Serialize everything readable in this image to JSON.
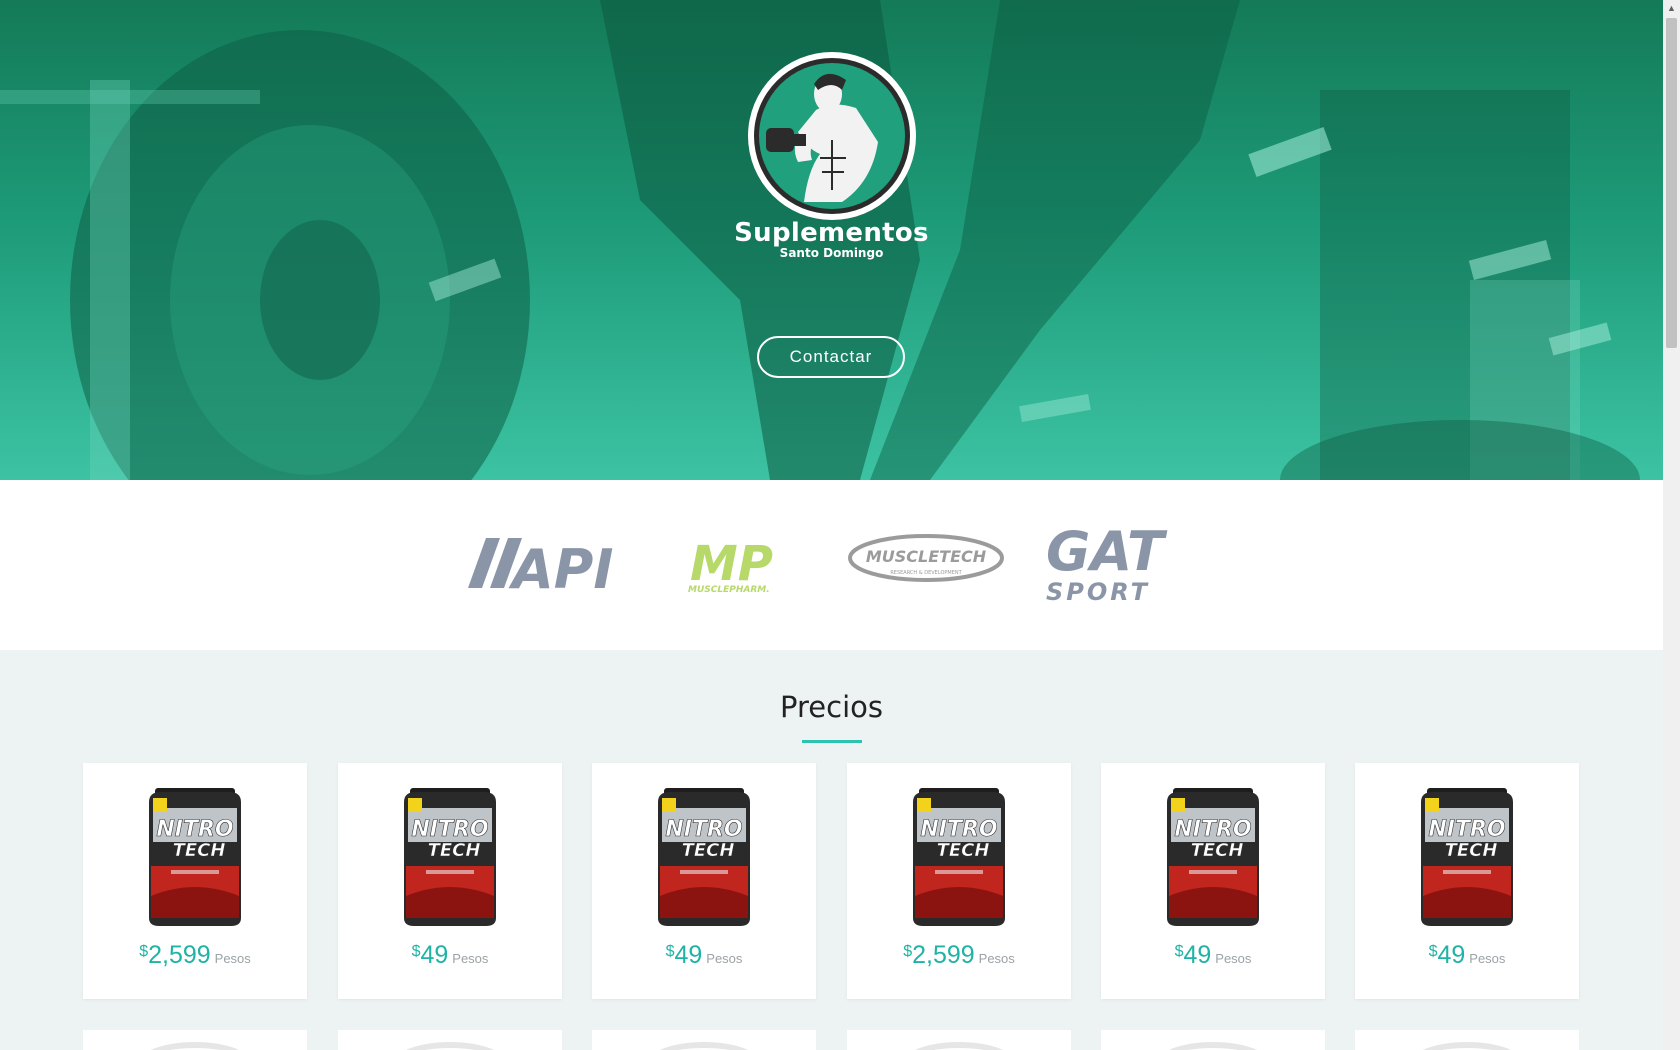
{
  "hero": {
    "brand_title": "Suplementos",
    "brand_subtitle": "Santo Domingo",
    "contact_label": "Contactar"
  },
  "brands": [
    {
      "name": "API",
      "color": "#8a96a8"
    },
    {
      "name": "MP",
      "sub": "MUSCLEPHARM.",
      "color": "#b7d96a"
    },
    {
      "name": "MUSCLETECH",
      "sub": "RESEARCH & DEVELOPMENT",
      "color": "#9b9b9b"
    },
    {
      "name": "GAT",
      "sub": "SPORT",
      "color": "#8a96a8"
    }
  ],
  "prices": {
    "title": "Precios",
    "products": [
      {
        "name": "NITRO TECH",
        "currency": "$",
        "amount": "2,599",
        "unit": "Pesos"
      },
      {
        "name": "NITRO TECH",
        "currency": "$",
        "amount": "49",
        "unit": "Pesos"
      },
      {
        "name": "NITRO TECH",
        "currency": "$",
        "amount": "49",
        "unit": "Pesos"
      },
      {
        "name": "NITRO TECH",
        "currency": "$",
        "amount": "2,599",
        "unit": "Pesos"
      },
      {
        "name": "NITRO TECH",
        "currency": "$",
        "amount": "49",
        "unit": "Pesos"
      },
      {
        "name": "NITRO TECH",
        "currency": "$",
        "amount": "49",
        "unit": "Pesos"
      }
    ]
  },
  "colors": {
    "accent": "#2cc3b0",
    "hero_top": "#147a57",
    "hero_bottom": "#3cc3a3"
  }
}
